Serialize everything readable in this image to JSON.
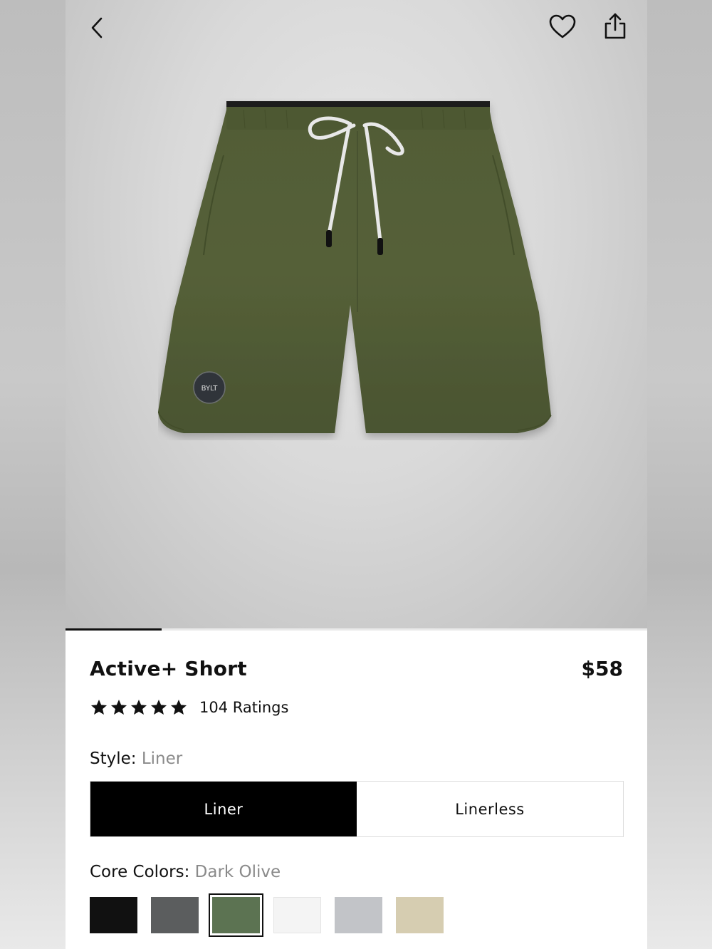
{
  "product": {
    "title": "Active+ Short",
    "price": "$58",
    "rating_count_text": "104 Ratings",
    "rating_stars": 5
  },
  "style": {
    "label": "Style:",
    "selected": "Liner",
    "options": [
      "Liner",
      "Linerless"
    ]
  },
  "colors": {
    "label": "Core Colors:",
    "selected": "Dark Olive",
    "swatches": [
      {
        "name": "black",
        "hex": "#111111"
      },
      {
        "name": "charcoal",
        "hex": "#5b5d5e"
      },
      {
        "name": "dark-olive",
        "hex": "#5c7352"
      },
      {
        "name": "white",
        "hex": "#f4f4f4"
      },
      {
        "name": "light-grey",
        "hex": "#c2c4c8"
      },
      {
        "name": "khaki",
        "hex": "#d6cdb1"
      }
    ]
  },
  "gallery": {
    "position_fraction": 0.165
  },
  "icons": {
    "back": "chevron-left-icon",
    "favorite": "heart-icon",
    "share": "share-icon",
    "star": "star-icon"
  },
  "brand_patch_text": "BYLT"
}
